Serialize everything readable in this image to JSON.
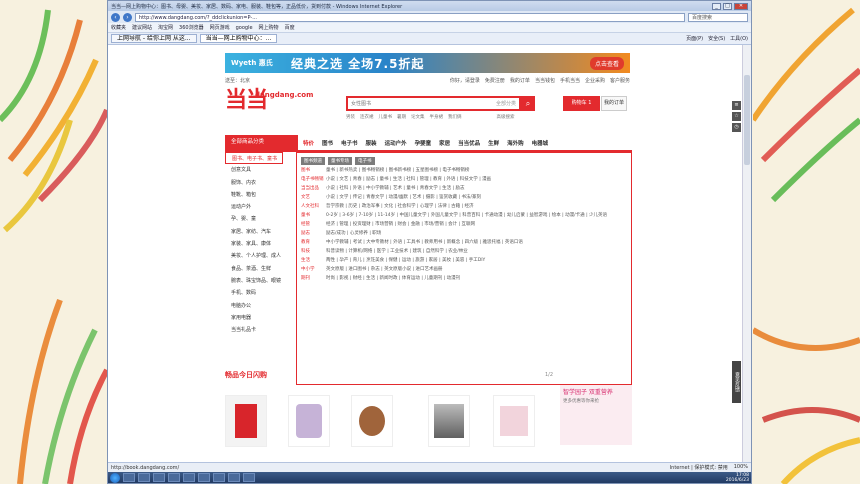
{
  "browser": {
    "title": "当当—网上购物中心：图书、母婴、美妆、家居、数码、家电、服装、鞋包等，正品低价，货到付款 - Windows Internet Explorer",
    "url": "http://www.dangdang.com/?_ddclickunion=P-...",
    "search_placeholder": "百度搜索",
    "favorites_label": "收藏夹",
    "fav_items": [
      "建议网站",
      "淘宝网",
      "360浏览器",
      "网页游戏",
      "google",
      "网上购物",
      "百度"
    ],
    "tabs": [
      "上网导航 - 给你上网 从这...",
      "当当—网上购物中心：..."
    ],
    "tools": [
      "页面(P)",
      "安全(S)",
      "工具(O)"
    ],
    "status_url": "http://book.dangdang.com/",
    "status_zone": "Internet | 保护模式: 禁用",
    "zoom": "100%",
    "clock_time": "17:08",
    "clock_date": "2016/6/23"
  },
  "site": {
    "banner_brand": "Wyeth 惠氏",
    "banner_slogan": "经典之选 全场7.5折起",
    "banner_cta": "点击查看",
    "region": "送至：北京",
    "top_links": [
      "你好，请登录",
      "免费注册",
      "我的订单",
      "当当钱包",
      "手机当当",
      "企业采购",
      "客户服务"
    ],
    "logo_text": "当当",
    "logo_sub": "dangdang.com",
    "search_placeholder": "女性图书",
    "search_category": "全部分类",
    "search_button": "搜",
    "hot_words": [
      "男装",
      "连衣裙",
      "儿童书",
      "暑期",
      "论文集",
      "半身裙",
      "我们俩"
    ],
    "advanced_search": "高级搜索",
    "cart_label": "购物车 1",
    "orders_label": "我的订单",
    "all_categories": "全部商品分类",
    "main_nav": [
      "图书",
      "电子书",
      "服装",
      "运动户外",
      "孕婴童",
      "家居",
      "当当优品",
      "生鲜",
      "海外购",
      "电器城"
    ],
    "main_nav_active": "特价",
    "sidebar": [
      "图书、电子书、童书",
      "创意文具",
      "服饰、内衣",
      "鞋靴、箱包",
      "运动户外",
      "孕、婴、童",
      "家居、家纺、汽车",
      "家装、家具、康体",
      "美妆、个人护理、成人",
      "食品、茶酒、生鲜",
      "腕表、珠宝饰品、眼镜",
      "手机、数码",
      "电脑办公",
      "家用电器",
      "当当礼品卡"
    ],
    "panel_tabs": [
      "图书频道",
      "童书专场",
      "电子书"
    ],
    "panel_rows": [
      {
        "h": "图书",
        "v": "童书 | 新书热卖 | 图书畅销榜 | 图书新书榜 | 五星图书榜 | 电子书畅销榜"
      },
      {
        "h": "电子书畅销",
        "v": "小说 | 文艺 | 青春 | 励志 | 童书 | 生活 | 社科 | 管理 | 教育 | 外语 | 科技文学 | 漫画"
      },
      {
        "h": "当当出品",
        "v": "小说 | 社科 | 外语 | 中小学教辅 | 艺术 | 童书 | 青春文学 | 生活 | 励志"
      },
      {
        "h": "文艺",
        "v": "小说 | 文学 | 传记 | 青春文学 | 动漫/幽默 | 艺术 | 摄影 | 鉴赏收藏 | 书法/篆刻"
      },
      {
        "h": "人文社科",
        "v": "哲学宗教 | 历史 | 政治军事 | 文化 | 社会科学 | 心理学 | 法律 | 古籍 | 经济"
      },
      {
        "h": "童书",
        "v": "0-2岁 | 3-6岁 | 7-10岁 | 11-14岁 | 中国儿童文学 | 外国儿童文学 | 科普百科 | 卡通动漫 | 幼儿启蒙 | 益智游戏 | 绘本 | 动漫/卡通 | 少儿英语"
      },
      {
        "h": "经管",
        "v": "经济 | 管理 | 投资理财 | 市场营销 | 财会 | 金融 | 市场/营销 | 会计 | 互联网"
      },
      {
        "h": "励志",
        "v": "励志/成功 | 心灵修养 | 职场"
      },
      {
        "h": "教育",
        "v": "中小学教辅 | 考试 | 大中专教材 | 外语 | 工具书 | 教师用书 | 新概念 | 四六级 | 雅思托福 | 英语口语"
      },
      {
        "h": "科技",
        "v": "科普读物 | 计算机/网络 | 医学 | 工业技术 | 建筑 | 自然科学 | 农业/林业"
      },
      {
        "h": "生活",
        "v": "两性 | 孕产 | 育儿 | 烹饪美食 | 保健 | 运动 | 旅游 | 家居 | 美妆 | 美容 | 手工DIY"
      },
      {
        "h": "中小学",
        "v": "英文原版 | 进口图书 | 杂志 | 英文原版小说 | 进口艺术画册"
      },
      {
        "h": "期刊",
        "v": "时尚 | 影视 | 财经 | 生活 | 新闻时政 | 体育运动 | 儿童期刊 | 动漫刊"
      }
    ],
    "section_title": "畅品今日闪购",
    "pager": "1/2",
    "promo_title": "智学园子 双重营养",
    "promo_sub": "更多优惠等你来抢",
    "side_feedback": "意见反馈"
  }
}
